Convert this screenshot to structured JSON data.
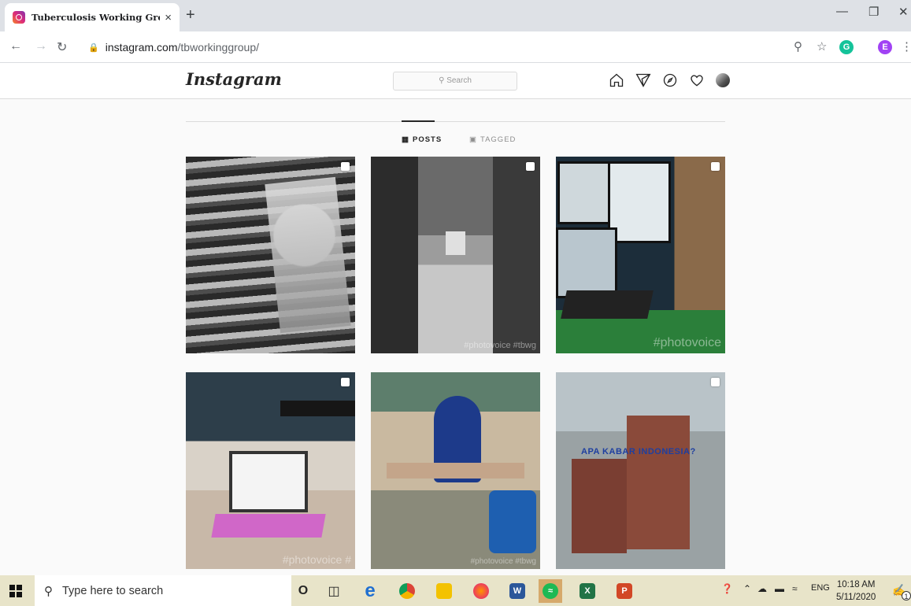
{
  "browser": {
    "tab_title": "Tuberculosis Working Group (",
    "tab_close": "×",
    "new_tab": "+",
    "url_host": "instagram.com",
    "url_path": "/tbworkinggroup/",
    "profile_initial": "E",
    "extension_initial": "G"
  },
  "instagram": {
    "logo": "Instagram",
    "search_placeholder": "Search",
    "tabs": [
      {
        "label": "POSTS",
        "active": true
      },
      {
        "label": "TAGGED",
        "active": false
      }
    ],
    "posts": [
      {
        "watermark": ""
      },
      {
        "watermark": "#photovoice #tbwg"
      },
      {
        "watermark": "#photovoice"
      },
      {
        "watermark": "#photovoice #"
      },
      {
        "watermark": "#photovoice #tbwg"
      },
      {
        "overlay_text": "APA KABAR INDONESIA?"
      }
    ]
  },
  "taskbar": {
    "search_placeholder": "Type here to search",
    "cortana": "O",
    "lang": "ENG",
    "time": "10:18 AM",
    "date": "5/11/2020",
    "notification_count": "1"
  },
  "colors": {
    "instagram_border": "#dbdbdb",
    "taskbar_bg": "#e8e4c9",
    "tab_bg": "#dee1e6"
  }
}
